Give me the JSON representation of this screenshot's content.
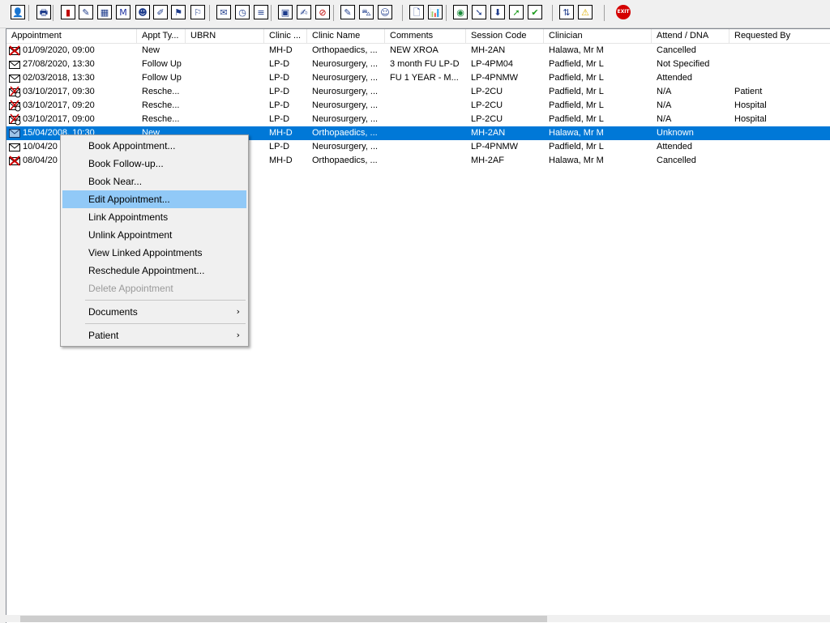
{
  "toolbar": {
    "buttons": [
      {
        "name": "patient-person-icon",
        "glyph": "👤"
      },
      {
        "name": "print-icon",
        "glyph": "🖶"
      },
      {
        "name": "book-icon",
        "glyph": "▮"
      },
      {
        "name": "edit-book-icon",
        "glyph": "✎"
      },
      {
        "name": "grid-icon",
        "glyph": "▦"
      },
      {
        "name": "m-icon",
        "glyph": "M"
      },
      {
        "name": "doctor-icon",
        "glyph": "☻"
      },
      {
        "name": "notes-icon",
        "glyph": "✐"
      },
      {
        "name": "flag-icon",
        "glyph": "⚑"
      },
      {
        "name": "flag-alt-icon",
        "glyph": "⚐"
      },
      {
        "name": "mail-icon",
        "glyph": "✉"
      },
      {
        "name": "clock-icon",
        "glyph": "◷"
      },
      {
        "name": "list-icon",
        "glyph": "≡"
      },
      {
        "name": "image-icon",
        "glyph": "▣"
      },
      {
        "name": "document-edit-icon",
        "glyph": "✍"
      },
      {
        "name": "no-entry-icon",
        "glyph": "⊘"
      },
      {
        "name": "note-icon",
        "glyph": "✎"
      },
      {
        "name": "bed-icon",
        "glyph": "⛍"
      },
      {
        "name": "person-edit-icon",
        "glyph": "☺"
      },
      {
        "name": "page-icon",
        "glyph": "🗋"
      },
      {
        "name": "bar-chart-icon",
        "glyph": "📊"
      },
      {
        "name": "globe-icon",
        "glyph": "◉"
      },
      {
        "name": "letter-arrow-icon",
        "glyph": "➘"
      },
      {
        "name": "letter-down-icon",
        "glyph": "⬇"
      },
      {
        "name": "green-arrow-icon",
        "glyph": "➚"
      },
      {
        "name": "green-check-icon",
        "glyph": "✔"
      },
      {
        "name": "sort-arrows-icon",
        "glyph": "⇅"
      },
      {
        "name": "warning-icon",
        "glyph": "⚠"
      },
      {
        "name": "exit-icon",
        "glyph": "EXIT"
      }
    ]
  },
  "columns": [
    "Appointment",
    "Appt Ty...",
    "UBRN",
    "Clinic ...",
    "Clinic Name",
    "Comments",
    "Session Code",
    "Clinician",
    "Attend / DNA",
    "Requested By"
  ],
  "rows": [
    {
      "icon": "cancelled",
      "cells": [
        "01/09/2020, 09:00",
        "New",
        "",
        "MH-D",
        "Orthopaedics, ...",
        "NEW XROA",
        "MH-2AN",
        "Halawa, Mr M",
        "Cancelled",
        ""
      ]
    },
    {
      "icon": "letter",
      "cells": [
        "27/08/2020, 13:30",
        "Follow Up",
        "",
        "LP-D",
        "Neurosurgery, ...",
        "3 month FU LP-D",
        "LP-4PM04",
        "Padfield, Mr L",
        "Not Specified",
        ""
      ]
    },
    {
      "icon": "letter",
      "cells": [
        "02/03/2018, 13:30",
        "Follow Up",
        "",
        "LP-D",
        "Neurosurgery, ...",
        "FU 1 YEAR - M...",
        "LP-4PNMW",
        "Padfield, Mr L",
        "Attended",
        ""
      ]
    },
    {
      "icon": "rescheduled",
      "cells": [
        "03/10/2017, 09:30",
        "Resche...",
        "",
        "LP-D",
        "Neurosurgery, ...",
        "",
        "LP-2CU",
        "Padfield, Mr L",
        "N/A",
        "Patient"
      ]
    },
    {
      "icon": "rescheduled",
      "cells": [
        "03/10/2017, 09:20",
        "Resche...",
        "",
        "LP-D",
        "Neurosurgery, ...",
        "",
        "LP-2CU",
        "Padfield, Mr L",
        "N/A",
        "Hospital"
      ]
    },
    {
      "icon": "rescheduled",
      "cells": [
        "03/10/2017, 09:00",
        "Resche...",
        "",
        "LP-D",
        "Neurosurgery, ...",
        "",
        "LP-2CU",
        "Padfield, Mr L",
        "N/A",
        "Hospital"
      ]
    },
    {
      "icon": "unknown",
      "selected": true,
      "cells": [
        "15/04/2008, 10:30",
        "New",
        "",
        "MH-D",
        "Orthopaedics, ...",
        "",
        "MH-2AN",
        "Halawa, Mr M",
        "Unknown",
        ""
      ]
    },
    {
      "icon": "letter",
      "cells": [
        "10/04/20",
        "",
        "",
        "LP-D",
        "Neurosurgery, ...",
        "",
        "LP-4PNMW",
        "Padfield, Mr L",
        "Attended",
        ""
      ]
    },
    {
      "icon": "cancelled",
      "cells": [
        "08/04/20",
        "",
        "",
        "MH-D",
        "Orthopaedics, ...",
        "",
        "MH-2AF",
        "Halawa, Mr M",
        "Cancelled",
        ""
      ]
    }
  ],
  "context_menu": {
    "items": [
      {
        "label": "Book Appointment...",
        "name": "menu-book-appointment"
      },
      {
        "label": "Book Follow-up...",
        "name": "menu-book-follow-up"
      },
      {
        "label": "Book Near...",
        "name": "menu-book-near"
      },
      {
        "label": "Edit Appointment...",
        "name": "menu-edit-appointment",
        "highlight": true
      },
      {
        "label": "Link Appointments",
        "name": "menu-link-appointments"
      },
      {
        "label": "Unlink Appointment",
        "name": "menu-unlink-appointment"
      },
      {
        "label": "View Linked Appointments",
        "name": "menu-view-linked-appointments"
      },
      {
        "label": "Reschedule Appointment...",
        "name": "menu-reschedule-appointment"
      },
      {
        "label": "Delete Appointment",
        "name": "menu-delete-appointment",
        "disabled": true
      },
      {
        "label": "Documents",
        "name": "menu-documents",
        "submenu": true
      },
      {
        "label": "Patient",
        "name": "menu-patient",
        "submenu": true
      }
    ],
    "submenu_arrow": "›"
  },
  "colors": {
    "selection": "#0078d7",
    "menu_highlight": "#91c9f7"
  }
}
